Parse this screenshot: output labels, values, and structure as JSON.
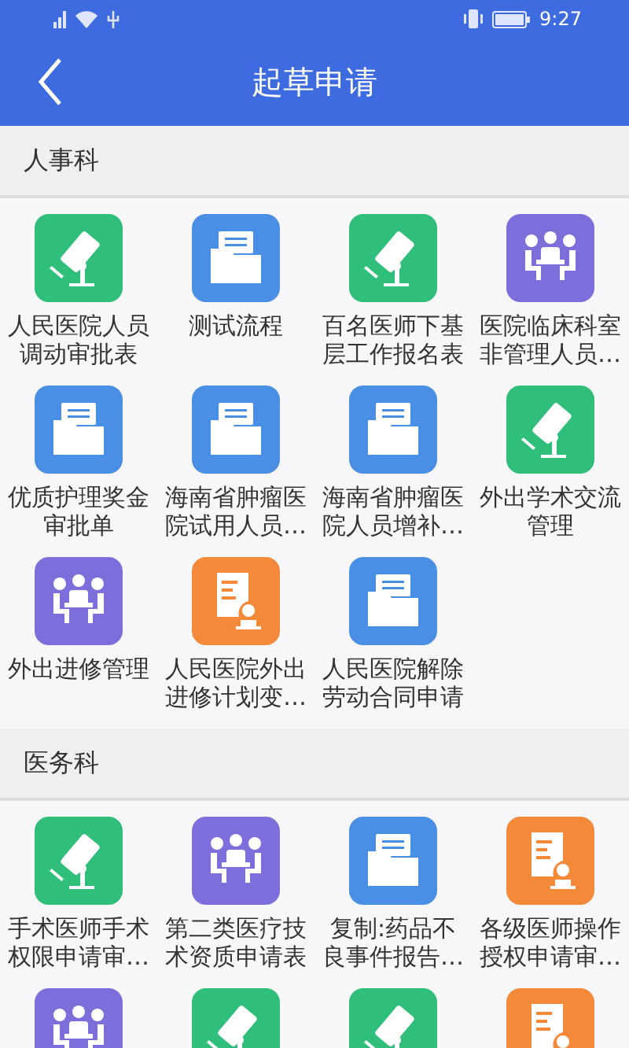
{
  "status_bar": {
    "time": "9:27"
  },
  "header": {
    "title": "起草申请"
  },
  "sections": [
    {
      "title": "人事科",
      "items": [
        {
          "kind": "microscope",
          "label": "人民医院人员调动审批表"
        },
        {
          "kind": "folder",
          "label": "测试流程"
        },
        {
          "kind": "microscope",
          "label": "百名医师下基层工作报名表"
        },
        {
          "kind": "meeting",
          "label": "医院临床科室非管理人员…"
        },
        {
          "kind": "folder",
          "label": "优质护理奖金审批单"
        },
        {
          "kind": "folder",
          "label": "海南省肿瘤医院试用人员…"
        },
        {
          "kind": "folder",
          "label": "海南省肿瘤医院人员增补…"
        },
        {
          "kind": "microscope",
          "label": "外出学术交流管理"
        },
        {
          "kind": "meeting",
          "label": "外出进修管理"
        },
        {
          "kind": "certificate",
          "label": "人民医院外出进修计划变…"
        },
        {
          "kind": "folder",
          "label": "人民医院解除劳动合同申请"
        }
      ]
    },
    {
      "title": "医务科",
      "items": [
        {
          "kind": "microscope",
          "label": "手术医师手术权限申请审…"
        },
        {
          "kind": "meeting",
          "label": "第二类医疗技术资质申请表"
        },
        {
          "kind": "folder",
          "label": "复制:药品不良事件报告…"
        },
        {
          "kind": "certificate",
          "label": "各级医师操作授权申请审…"
        },
        {
          "kind": "meeting"
        },
        {
          "kind": "microscope"
        },
        {
          "kind": "microscope"
        },
        {
          "kind": "certificate"
        }
      ]
    }
  ]
}
